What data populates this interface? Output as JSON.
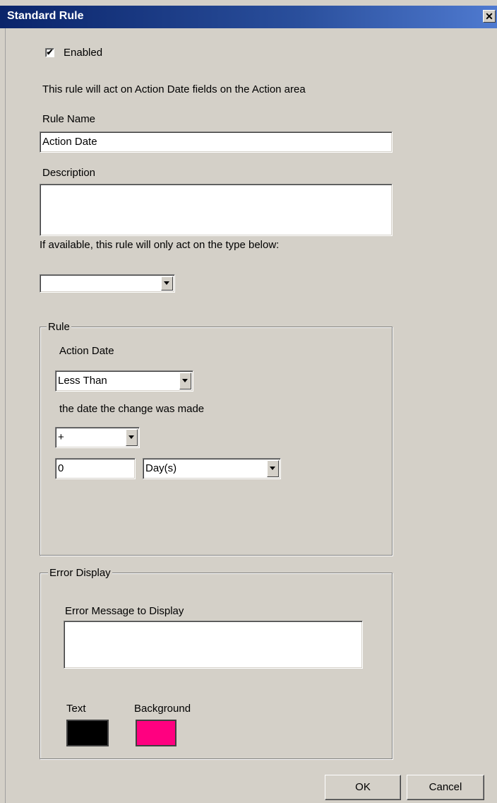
{
  "window": {
    "title": "Standard Rule",
    "close_glyph": "✕"
  },
  "enabled": {
    "label": "Enabled",
    "checked": true,
    "check_glyph": "✔"
  },
  "info_text": "This rule will act on Action Date fields on the Action area",
  "rule_name": {
    "label": "Rule Name",
    "value": "Action Date"
  },
  "description": {
    "label": "Description",
    "value": ""
  },
  "type_filter": {
    "label": "If available, this rule will only act on the type below:",
    "selected": ""
  },
  "rule_group": {
    "legend": "Rule",
    "field_label": "Action Date",
    "operator": {
      "selected": "Less Than"
    },
    "relative_text": "the date the change was made",
    "sign": {
      "selected": "+"
    },
    "offset": {
      "value": "0"
    },
    "unit": {
      "selected": "Day(s)"
    }
  },
  "error_group": {
    "legend": "Error Display",
    "message_label": "Error Message to Display",
    "message_value": "",
    "text_color_label": "Text",
    "text_color": "#000000",
    "background_color_label": "Background",
    "background_color": "#ff0080"
  },
  "buttons": {
    "ok": "OK",
    "cancel": "Cancel"
  }
}
